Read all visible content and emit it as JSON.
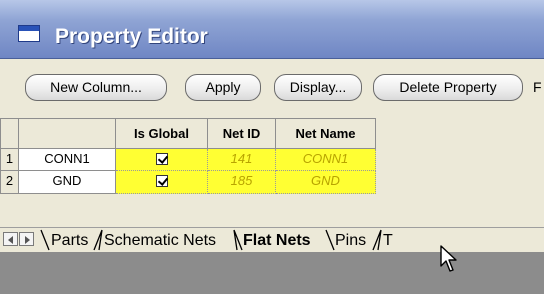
{
  "window": {
    "title": "Property Editor"
  },
  "toolbar": {
    "buttons": [
      {
        "label": "New Column..."
      },
      {
        "label": "Apply"
      },
      {
        "label": "Display..."
      },
      {
        "label": "Delete Property"
      }
    ],
    "overflow_label": "F"
  },
  "grid": {
    "columns": [
      "Is Global",
      "Net ID",
      "Net Name"
    ],
    "rows": [
      {
        "num": "1",
        "name": "CONN1",
        "is_global": true,
        "net_id": "141",
        "net_name": "CONN1"
      },
      {
        "num": "2",
        "name": "GND",
        "is_global": true,
        "net_id": "185",
        "net_name": "GND"
      }
    ]
  },
  "tabs": {
    "items": [
      {
        "label": "Parts",
        "active": false
      },
      {
        "label": "Schematic Nets",
        "active": false
      },
      {
        "label": "Flat Nets",
        "active": true
      },
      {
        "label": "Pins",
        "active": false
      },
      {
        "label": "T",
        "active": false
      }
    ]
  },
  "colors": {
    "title_bar": "#6f86c4",
    "editable_cell": "#ffff33",
    "cell_text": "#b8a400"
  }
}
